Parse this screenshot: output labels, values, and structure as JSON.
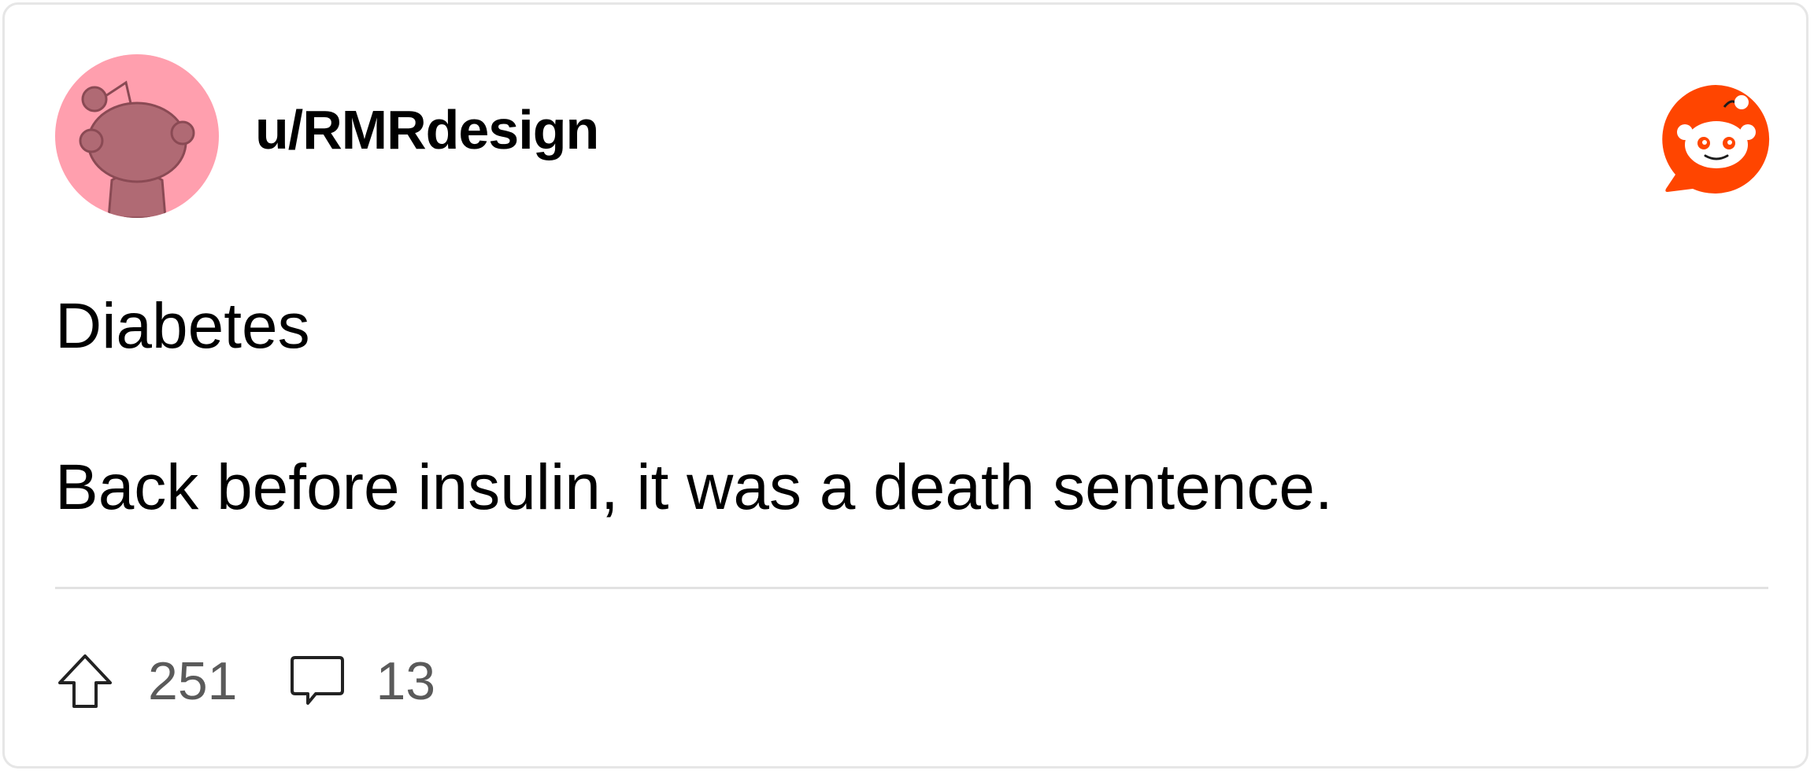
{
  "post": {
    "username": "u/RMRdesign",
    "title": "Diabetes",
    "body": "Back before insulin, it was a death sentence.",
    "upvotes": "251",
    "comments": "13"
  },
  "icons": {
    "avatar": "snoo-avatar-icon",
    "brand": "reddit-logo-icon",
    "upvote": "upvote-arrow-icon",
    "comment": "comment-bubble-icon"
  },
  "colors": {
    "avatar_bg": "#ff9fae",
    "brand": "#ff4500",
    "count_text": "#5a5a5a",
    "divider": "#e2e2e2"
  }
}
